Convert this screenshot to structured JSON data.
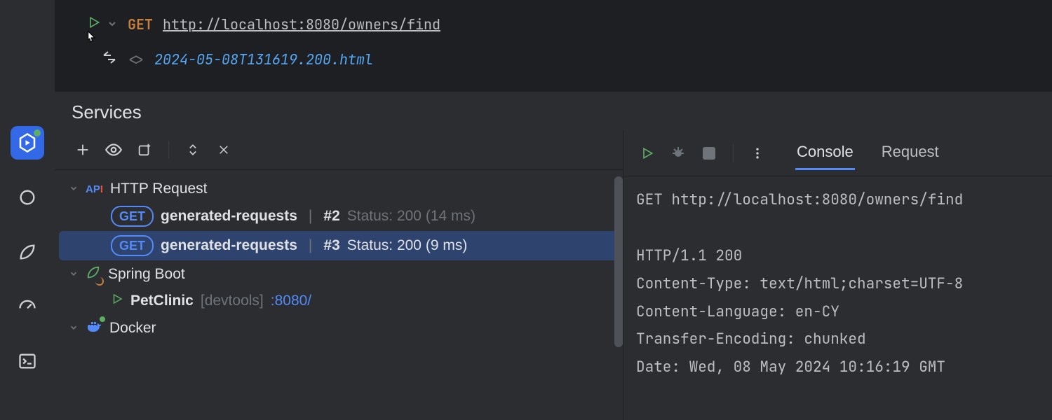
{
  "editor": {
    "method": "GET",
    "url": "http://localhost:8080/owners/find",
    "response_file": "2024-05-08T131619.200.html"
  },
  "services": {
    "title": "Services",
    "tree": {
      "http_label": "HTTP Request",
      "req2": {
        "badge": "GET",
        "name": "generated-requests",
        "num": "#2",
        "status": "Status: 200 (14 ms)"
      },
      "req3": {
        "badge": "GET",
        "name": "generated-requests",
        "num": "#3",
        "status": "Status: 200 (9 ms)"
      },
      "spring_label": "Spring Boot",
      "app_name": "PetClinic",
      "app_profile": "[devtools]",
      "app_port": ":8080/",
      "docker_label": "Docker"
    }
  },
  "output": {
    "tabs": {
      "console": "Console",
      "request": "Request"
    },
    "lines": {
      "l1": "GET http://localhost:8080/owners/find",
      "l2": "",
      "l3": "HTTP/1.1 200 ",
      "l4": "Content-Type: text/html;charset=UTF-8",
      "l5": "Content-Language: en-CY",
      "l6": "Transfer-Encoding: chunked",
      "l7": "Date: Wed, 08 May 2024 10:16:19 GMT"
    }
  }
}
